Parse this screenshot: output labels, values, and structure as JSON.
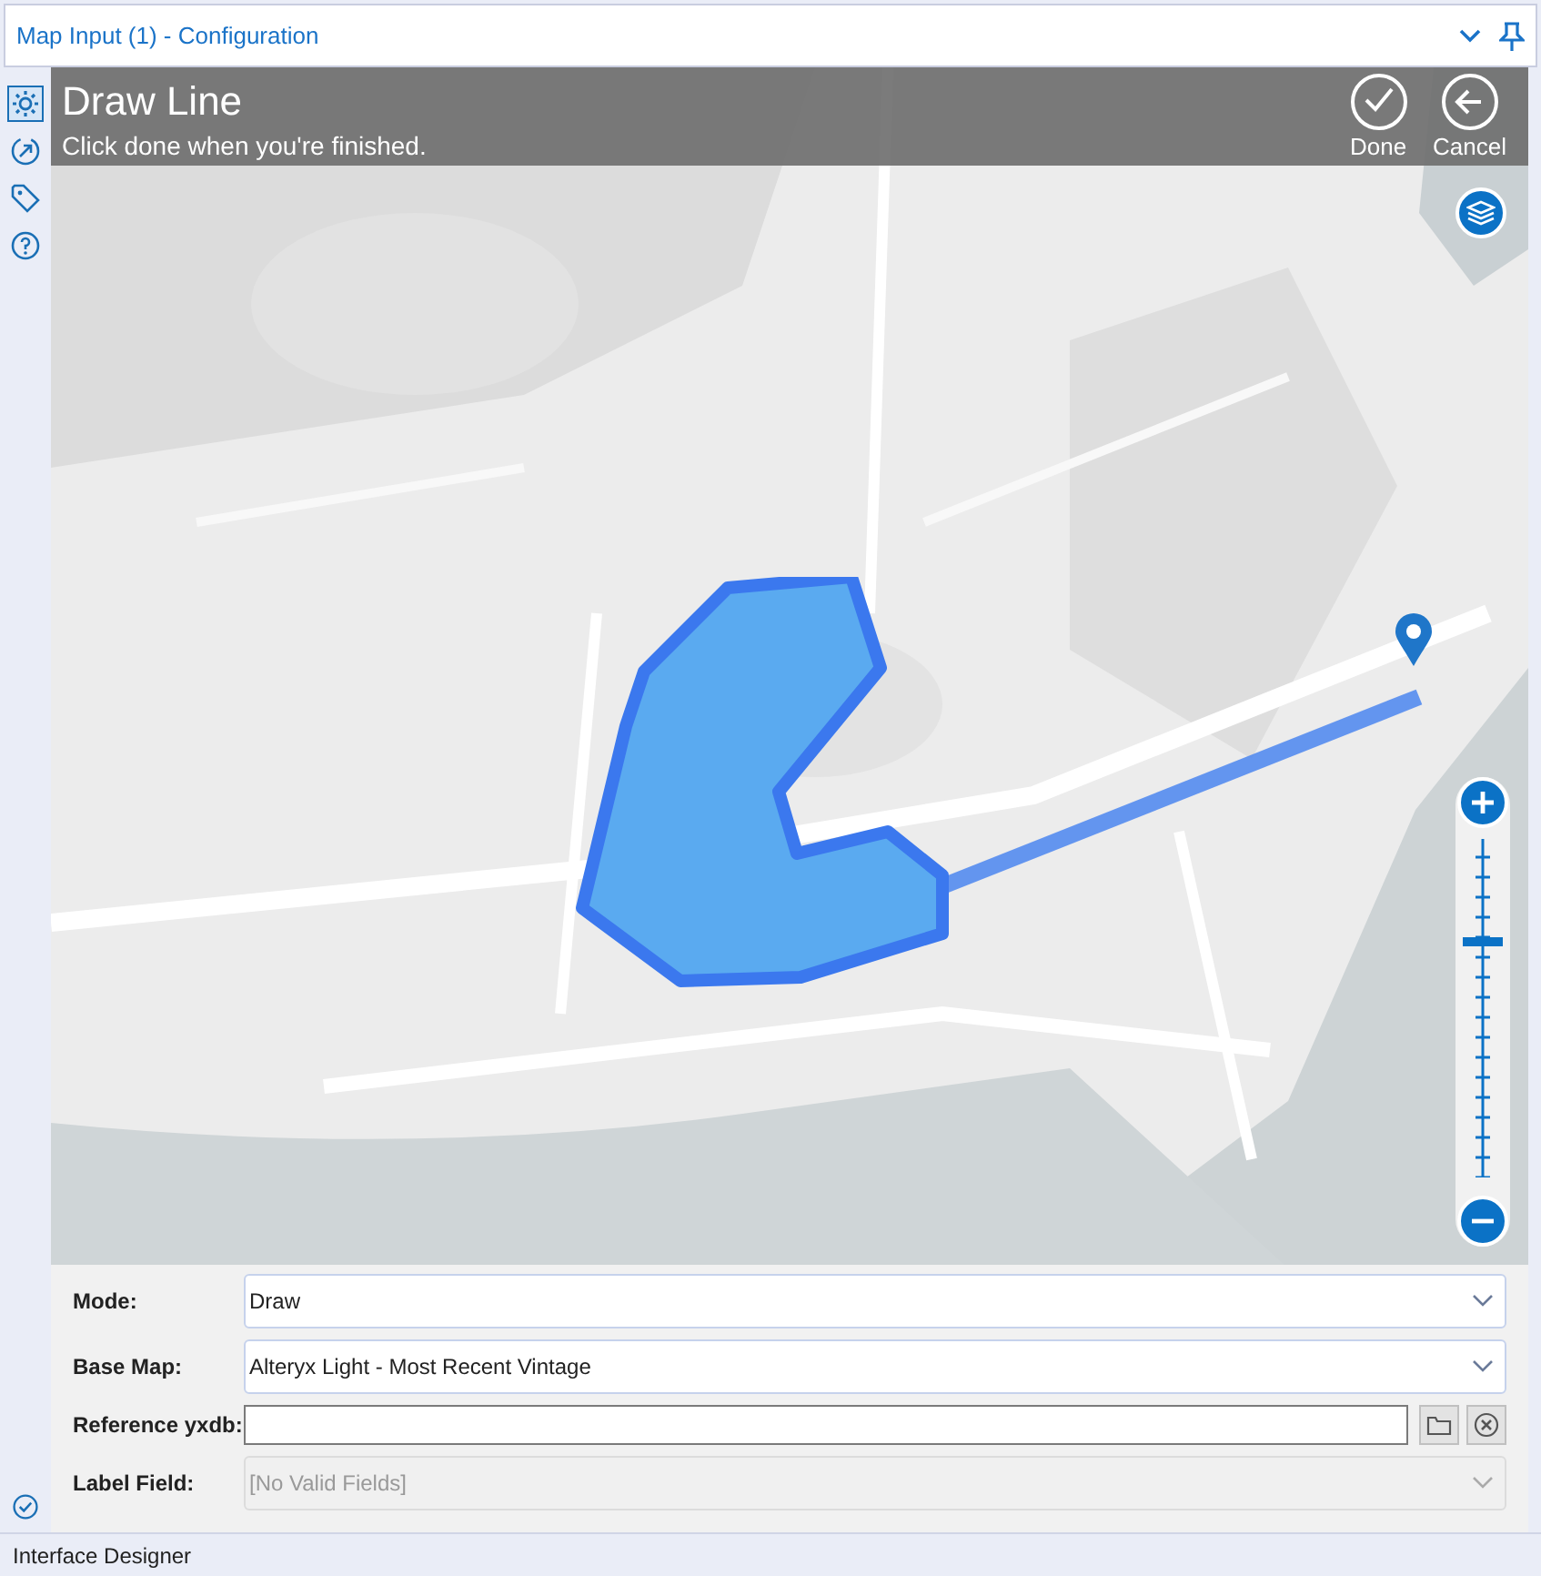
{
  "window": {
    "title": "Map Input (1) - Configuration"
  },
  "sidebar": {
    "items": [
      {
        "selected": true
      },
      {
        "selected": false
      },
      {
        "selected": false
      },
      {
        "selected": false
      }
    ]
  },
  "map": {
    "kind": "picture",
    "overlay": {
      "title": "Draw Line",
      "subtitle": "Click done when you're finished.",
      "actions": [
        {
          "kind": "done",
          "label": "Done"
        },
        {
          "kind": "cancel",
          "label": "Cancel"
        }
      ]
    },
    "zoom": {
      "level": 0.69
    }
  },
  "form": {
    "fields": [
      {
        "kind": "dropdown",
        "label": "Mode:",
        "value": "Draw",
        "disabled": false
      },
      {
        "kind": "dropdown",
        "label": "Base Map:",
        "value": "Alteryx Light - Most Recent Vintage",
        "disabled": false
      },
      {
        "kind": "file",
        "label": "Reference yxdb:"
      },
      {
        "kind": "dropdown",
        "label": "Label Field:",
        "value": "[No Valid Fields]",
        "disabled": true
      }
    ]
  },
  "status_bar": {
    "text": "Interface Designer"
  }
}
